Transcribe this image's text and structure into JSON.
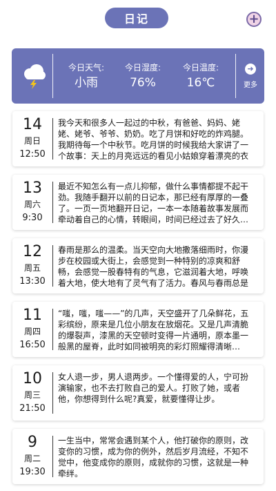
{
  "header": {
    "title": "日记"
  },
  "weather": {
    "items": [
      {
        "label": "今日天气:",
        "value": "小雨"
      },
      {
        "label": "今日湿度:",
        "value": "76%"
      },
      {
        "label": "今日温度:",
        "value": "16℃"
      }
    ],
    "more_label": "更多",
    "icon": "rain-thunder-cloud-icon"
  },
  "entries": [
    {
      "day": "14",
      "weekday": "周日",
      "time": "12:50",
      "text": "我今天和很多人一起过的中秋，有爸爸、妈妈、姥姥、姥爷、爷爷、奶奶。吃了月饼和好吃的炸鸡腿。我期待每一个中秋节。吃月饼的时候我给大家讲了一个故事：天上的月亮远远的看见小姑娘穿着漂亮的衣服…"
    },
    {
      "day": "13",
      "weekday": "周六",
      "time": "9:30",
      "text": "最近不知怎么有一点儿抑郁，做什么事情都提不起干劲。我随手翻开以前的日记本，那已经有厚厚的一叠了。一页一页地翻开日记，一本一本随着故事发展而牵动着自己的心情，转眼间，时间已经过去了好久…"
    },
    {
      "day": "12",
      "weekday": "周五",
      "time": "13:30",
      "text": "春雨是那么的温柔。当天空向大地撒落细雨时，你漫步在校园或大街上，会感觉到一种特别的凉爽和舒畅，会感觉一股春特有的气息，它滋润着大地，呼唤着大地，使大地有了灵气有了活力。春风与春雨总是结…"
    },
    {
      "day": "11",
      "weekday": "周四",
      "time": "16:50",
      "text": "“嗤，嗤，嗤——”的几声，天空盛开了几朵鲜花，五彩缤纷，原来是几位小朋友在放烟花。又是几声清脆的爆裂声，漆黑的天空顿时变得一片通明，原本墨一般黑的屋脊，此时如同被明亮的彩灯照耀得清晰…"
    },
    {
      "day": "10",
      "weekday": "周三",
      "time": "21:50",
      "text": "女人退一步，男人退两步。一个懂得爱的人，宁可扮演输家，也不去打败自己的爱人。打败了她，或者他，你想得到什么呢?真爱，就要懂得让步。"
    },
    {
      "day": "9",
      "weekday": "周二",
      "time": "19:30",
      "text": "一生当中，常常会遇到某个人，他打破你的原则，改变你的习惯，成为你的例外，然后岁月流经，不知不觉中，他变成你的原则，成就你的习惯，这就是一种牵绊。"
    }
  ],
  "colors": {
    "accent": "#6b73b7",
    "add_button_bg": "#f0d4e6"
  }
}
